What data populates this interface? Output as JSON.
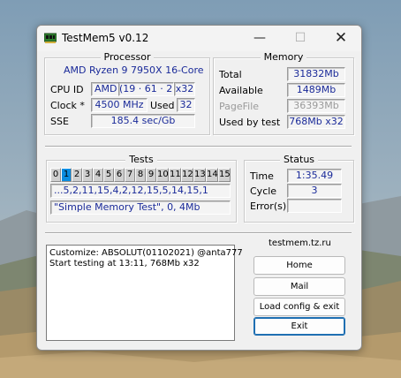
{
  "window": {
    "title": "TestMem5 v0.12",
    "minimize": "—",
    "maximize": "☐",
    "close": "✕"
  },
  "processor": {
    "legend": "Processor",
    "name": "AMD Ryzen 9 7950X 16-Core",
    "cpuid_label": "CPU ID",
    "cpuid_vendor": "AMD",
    "cpuid_sig": "(19 · 61 · 2)",
    "cpuid_arch": "x32",
    "clock_label": "Clock *",
    "clock_value": "4500 MHz",
    "used_label": "Used",
    "used_value": "32",
    "sse_label": "SSE",
    "sse_value": "185.4 sec/Gb"
  },
  "memory": {
    "legend": "Memory",
    "total_label": "Total",
    "total_value": "31832Mb",
    "available_label": "Available",
    "available_value": "1489Mb",
    "pagefile_label": "PageFile",
    "pagefile_value": "36393Mb",
    "usedbytest_label": "Used by test",
    "usedbytest_value": "768Mb x32"
  },
  "tests": {
    "legend": "Tests",
    "cells": [
      "0",
      "1",
      "2",
      "3",
      "4",
      "5",
      "6",
      "7",
      "8",
      "9",
      "10",
      "11",
      "12",
      "13",
      "14",
      "15"
    ],
    "active_index": 1,
    "sequence": "...5,2,11,15,4,2,12,15,5,14,15,1",
    "description": "\"Simple Memory Test\", 0, 4Mb"
  },
  "status": {
    "legend": "Status",
    "time_label": "Time",
    "time_value": "1:35.49",
    "cycle_label": "Cycle",
    "cycle_value": "3",
    "errors_label": "Error(s)",
    "errors_value": ""
  },
  "log": {
    "lines": [
      "Customize: ABSOLUT(01102021) @anta777",
      "Start testing at 13:11, 768Mb x32"
    ]
  },
  "side": {
    "site": "testmem.tz.ru",
    "home_button": "Home",
    "mail_button": "Mail",
    "load_button": "Load config & exit",
    "exit_button": "Exit"
  }
}
